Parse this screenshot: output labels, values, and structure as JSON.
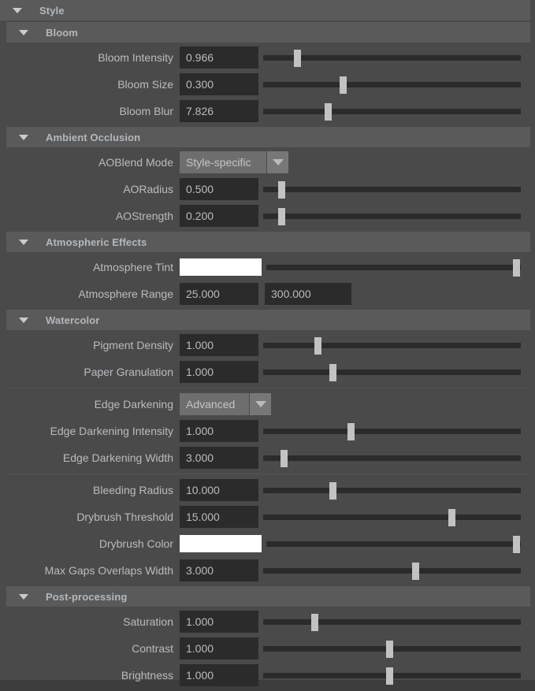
{
  "panel": {
    "title": "Style",
    "root_header": {
      "label": "Style",
      "icon": "chevron-down-icon",
      "expanded": true
    }
  },
  "sections": [
    {
      "id": "bloom",
      "label": "Bloom",
      "icon": "chevron-down-icon",
      "expanded": true,
      "rows": [
        {
          "name": "bloom-intensity",
          "label": "Bloom Intensity",
          "type": "slider",
          "value": "0.966",
          "knob_pct": 13
        },
        {
          "name": "bloom-size",
          "label": "Bloom Size",
          "type": "slider",
          "value": "0.300",
          "knob_pct": 31
        },
        {
          "name": "bloom-blur",
          "label": "Bloom Blur",
          "type": "slider",
          "value": "7.826",
          "knob_pct": 25
        }
      ]
    },
    {
      "id": "ambient-occlusion",
      "label": "Ambient Occlusion",
      "icon": "chevron-down-icon",
      "expanded": true,
      "rows": [
        {
          "name": "ao-blend-mode",
          "label": "AOBlend Mode",
          "type": "dropdown",
          "value": "Style-specific",
          "width": "w-style"
        },
        {
          "name": "ao-radius",
          "label": "AORadius",
          "type": "slider",
          "value": "0.500",
          "knob_pct": 7
        },
        {
          "name": "ao-strength",
          "label": "AOStrength",
          "type": "slider",
          "value": "0.200",
          "knob_pct": 7
        }
      ]
    },
    {
      "id": "atmospheric-effects",
      "label": "Atmospheric Effects",
      "icon": "chevron-down-icon",
      "expanded": true,
      "rows": [
        {
          "name": "atmosphere-tint",
          "label": "Atmosphere Tint",
          "type": "color-slider",
          "color": "#ffffff",
          "knob_pct": 98
        },
        {
          "name": "atmosphere-range",
          "label": "Atmosphere Range",
          "type": "dual-field",
          "value": "25.000",
          "value2": "300.000"
        }
      ]
    },
    {
      "id": "watercolor",
      "label": "Watercolor",
      "icon": "chevron-down-icon",
      "expanded": true,
      "rows": [
        {
          "name": "pigment-density",
          "label": "Pigment Density",
          "type": "slider",
          "value": "1.000",
          "knob_pct": 21
        },
        {
          "name": "paper-granulation",
          "label": "Paper Granulation",
          "type": "slider",
          "value": "1.000",
          "knob_pct": 27
        },
        {
          "name": "separator-1",
          "type": "separator"
        },
        {
          "name": "edge-darkening",
          "label": "Edge Darkening",
          "type": "dropdown",
          "value": "Advanced",
          "width": "w-adv"
        },
        {
          "name": "edge-darkening-intensity",
          "label": "Edge Darkening Intensity",
          "type": "slider",
          "value": "1.000",
          "knob_pct": 34
        },
        {
          "name": "edge-darkening-width",
          "label": "Edge Darkening Width",
          "type": "slider",
          "value": "3.000",
          "knob_pct": 8
        },
        {
          "name": "separator-2",
          "type": "separator"
        },
        {
          "name": "bleeding-radius",
          "label": "Bleeding Radius",
          "type": "slider",
          "value": "10.000",
          "knob_pct": 27
        },
        {
          "name": "drybrush-threshold",
          "label": "Drybrush Threshold",
          "type": "slider",
          "value": "15.000",
          "knob_pct": 73
        },
        {
          "name": "drybrush-color",
          "label": "Drybrush Color",
          "type": "color-slider",
          "color": "#ffffff",
          "knob_pct": 98
        },
        {
          "name": "max-gaps-overlaps-width",
          "label": "Max Gaps Overlaps Width",
          "type": "slider",
          "value": "3.000",
          "knob_pct": 59
        }
      ]
    },
    {
      "id": "post-processing",
      "label": "Post-processing",
      "icon": "chevron-down-icon",
      "expanded": true,
      "rows": [
        {
          "name": "saturation",
          "label": "Saturation",
          "type": "slider",
          "value": "1.000",
          "knob_pct": 20
        },
        {
          "name": "contrast",
          "label": "Contrast",
          "type": "slider",
          "value": "1.000",
          "knob_pct": 49
        },
        {
          "name": "brightness",
          "label": "Brightness",
          "type": "slider",
          "value": "1.000",
          "knob_pct": 49
        }
      ]
    }
  ],
  "colors": {
    "panel_bg": "#4a4a4a",
    "header_bg": "#5a5a5a",
    "field_bg": "#2b2b2b",
    "track_bg": "#2b2b2b",
    "knob": "#c2c2c2",
    "text": "#b9bcbf",
    "combo_bg": "#6e6e6e"
  }
}
